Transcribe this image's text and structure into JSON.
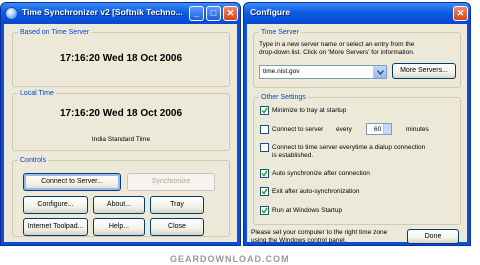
{
  "time_sync": {
    "title": "Time Synchronizer v2 [Softnik Techno...",
    "groups": {
      "server": "Based on Time Server",
      "local": "Local Time",
      "controls": "Controls"
    },
    "server_time": "17:16:20 Wed 18 Oct 2006",
    "local_time": "17:16:20 Wed 18 Oct 2006",
    "timezone": "India Standard Time",
    "buttons": {
      "connect": "Connect to Server...",
      "synchronize": "Synchronize",
      "configure": "Configure...",
      "about": "About...",
      "tray": "Tray",
      "internet_toolpad": "Internet Toolpad...",
      "help": "Help...",
      "close": "Close"
    }
  },
  "configure": {
    "title": "Configure",
    "time_server_group": "Time Server",
    "instructions": [
      "Type in a new server name or select an entry from the",
      "drop-down list. Click on 'More Servers' for information."
    ],
    "server_value": "time.nist.gov",
    "more_servers": "More Servers...",
    "other_group": "Other Settings",
    "options": {
      "minimize": {
        "label": "Minimize to tray at startup",
        "checked": true
      },
      "connect_every": {
        "label": "Connect to server",
        "label_every": "every",
        "minutes_value": "60",
        "label_minutes": "minutes",
        "checked": false
      },
      "dialup": {
        "label_line1": "Connect to time server everytime a dialup connection",
        "label_line2": "is established.",
        "checked": false
      },
      "auto_sync": {
        "label": "Auto synchronize after connection",
        "checked": true
      },
      "exit_after": {
        "label": "Exit after auto-synchronization",
        "checked": true
      },
      "run_startup": {
        "label": "Run at Windows Startup",
        "checked": true
      }
    },
    "footer_text": [
      "Please set your computer to the right time zone",
      "using the Windows control panel."
    ],
    "done": "Done"
  },
  "watermark": "GEARDOWNLOAD.COM"
}
